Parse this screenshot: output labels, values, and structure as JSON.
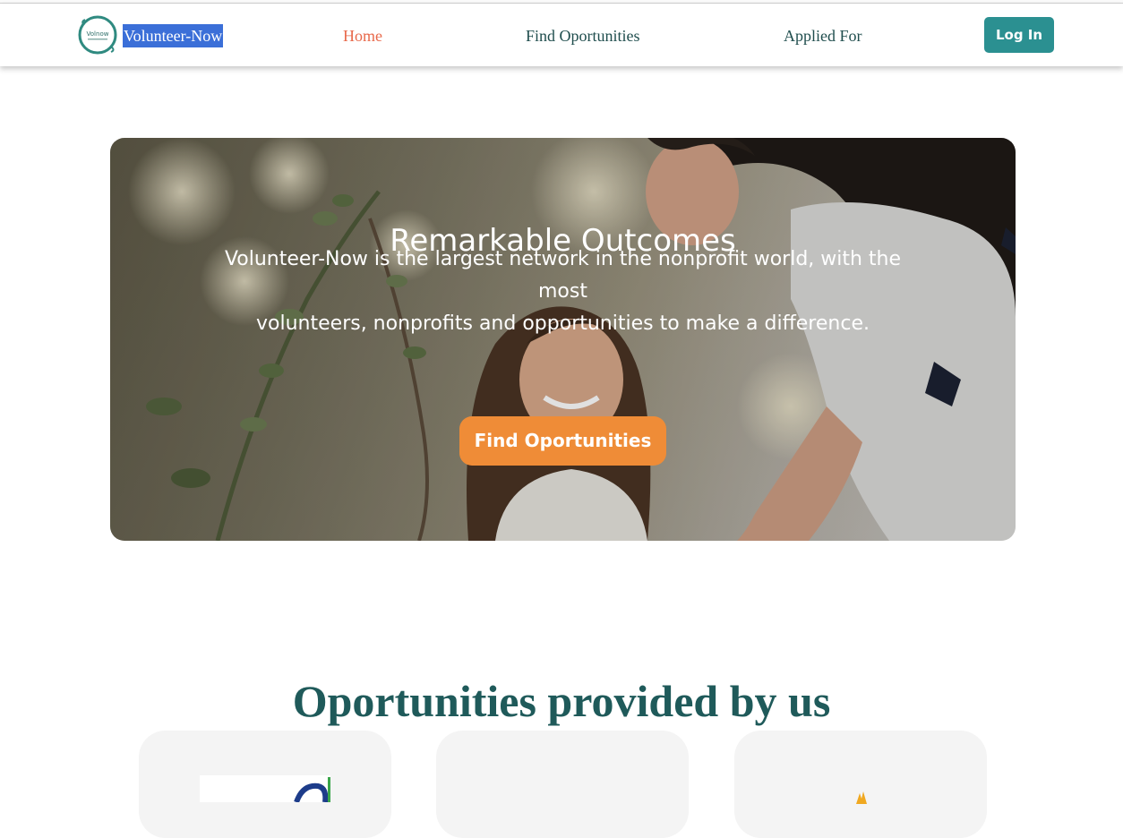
{
  "brand": {
    "name": "Volunteer-Now",
    "logo_text": "Volnow",
    "logo_icon": "circle-logo-icon",
    "accent": "#2b9091"
  },
  "nav": {
    "home": "Home",
    "find": "Find Oportunities",
    "applied": "Applied For",
    "login": "Log In",
    "active_color": "#e8694b"
  },
  "hero": {
    "title": "Remarkable Outcomes",
    "line1": "Volunteer-Now is the largest network in the nonprofit world, with the most",
    "line2": "volunteers, nonprofits and opportunities to make a difference.",
    "cta": "Find Oportunities",
    "cta_color": "#ef8c37"
  },
  "section": {
    "title": "Oportunities provided by us"
  }
}
